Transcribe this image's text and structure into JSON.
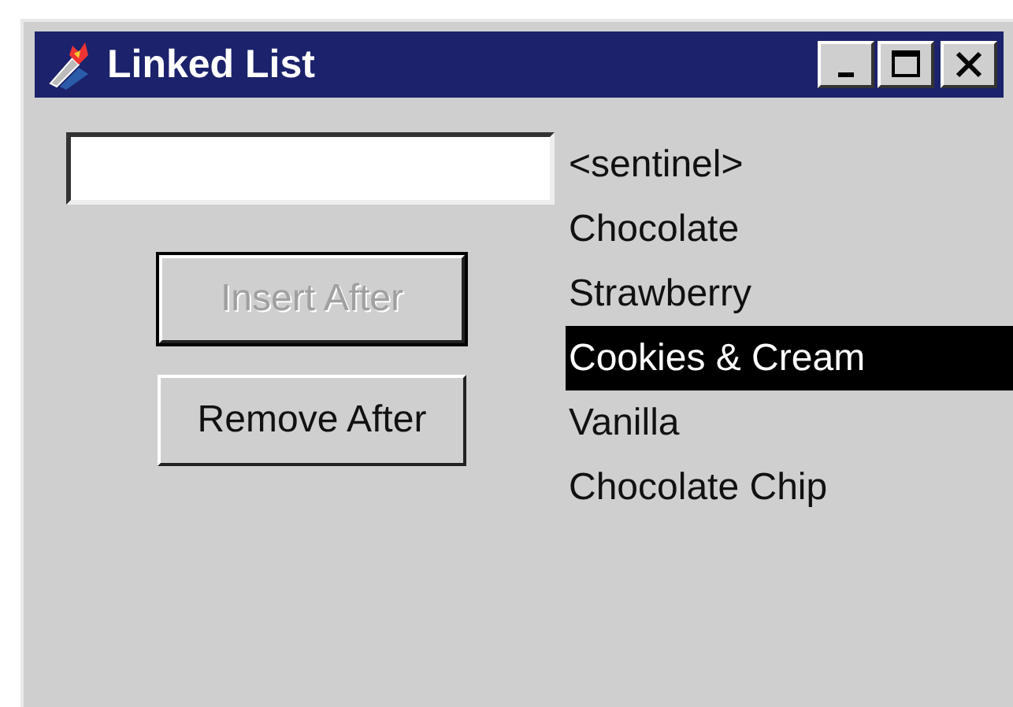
{
  "window": {
    "title": "Linked List"
  },
  "buttons": [
    {
      "label": "Insert After",
      "disabled": true,
      "default": true
    },
    {
      "label": "Remove After",
      "disabled": false,
      "default": false
    }
  ],
  "list": {
    "items": [
      {
        "label": "<sentinel>",
        "selected": false
      },
      {
        "label": "Chocolate",
        "selected": false
      },
      {
        "label": "Strawberry",
        "selected": false
      },
      {
        "label": "Cookies & Cream",
        "selected": true
      },
      {
        "label": "Vanilla",
        "selected": false
      },
      {
        "label": "Chocolate Chip",
        "selected": false
      }
    ]
  }
}
